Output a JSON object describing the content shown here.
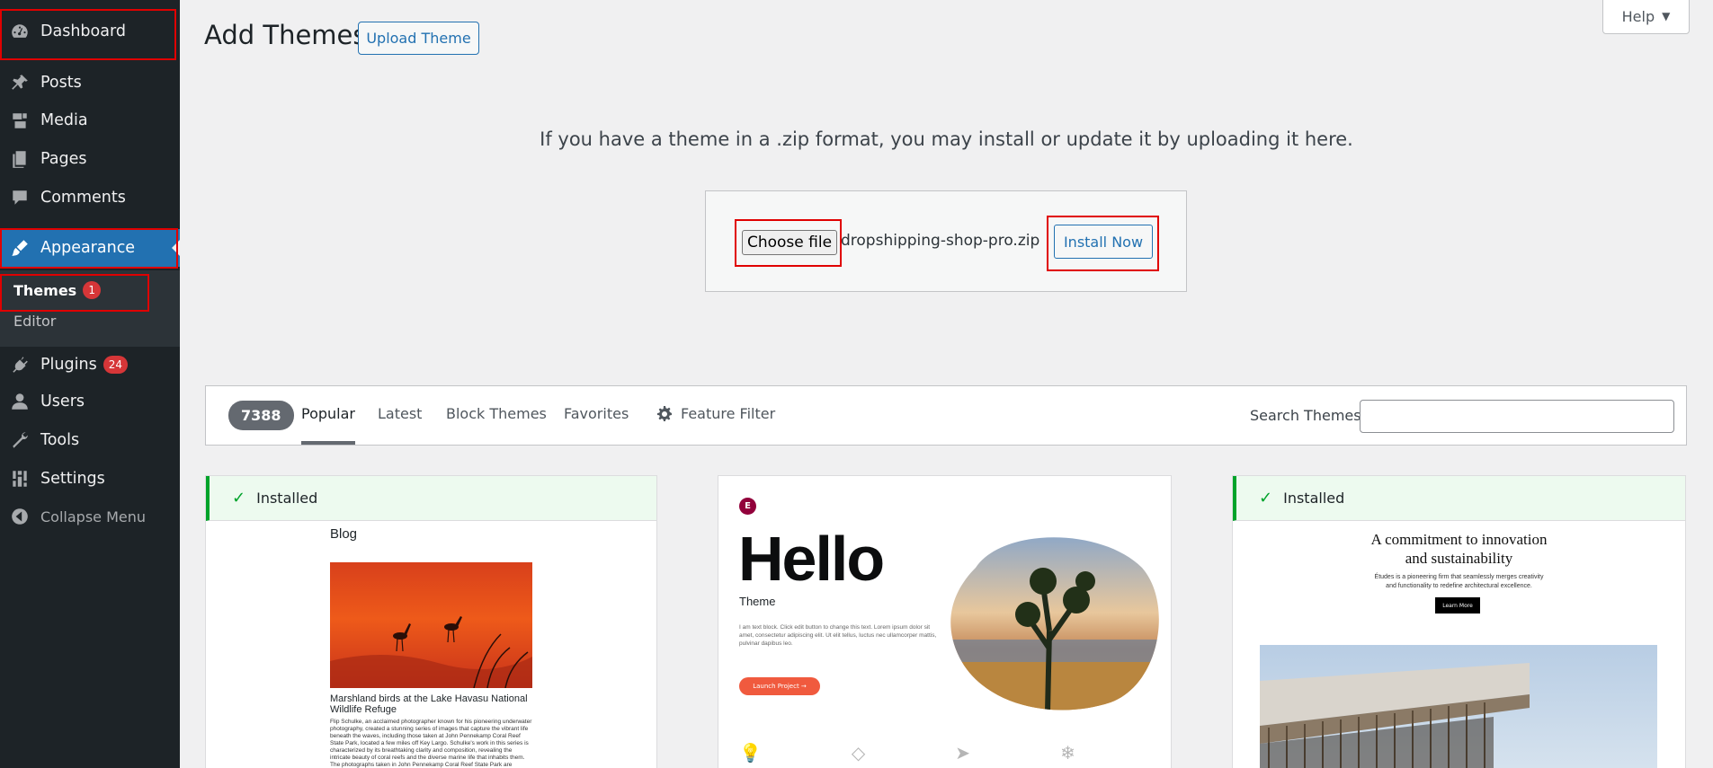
{
  "sidebar": {
    "dashboard": "Dashboard",
    "posts": "Posts",
    "media": "Media",
    "pages": "Pages",
    "comments": "Comments",
    "appearance": "Appearance",
    "themes": "Themes",
    "themes_count": "1",
    "editor": "Editor",
    "plugins": "Plugins",
    "plugins_count": "24",
    "users": "Users",
    "tools": "Tools",
    "settings": "Settings",
    "collapse": "Collapse Menu"
  },
  "header": {
    "title": "Add Themes",
    "upload_button": "Upload Theme",
    "help": "Help"
  },
  "upload": {
    "message": "If you have a theme in a .zip format, you may install or update it by uploading it here.",
    "choose_file": "Choose file",
    "file_name": "dropshipping-shop-pro.zip",
    "install_now": "Install Now"
  },
  "filter": {
    "count": "7388",
    "tabs": [
      "Popular",
      "Latest",
      "Block Themes",
      "Favorites"
    ],
    "feature_filter": "Feature Filter",
    "search_label": "Search Themes",
    "search_value": ""
  },
  "themes": [
    {
      "installed": "Installed",
      "preview_title": "Blog",
      "preview_caption": "Marshland birds at the Lake Havasu National Wildlife Refuge",
      "preview_body": "Flip Schulke, an acclaimed photographer known for his pioneering underwater photography, created a stunning series of images that capture the vibrant life beneath the waves, including those taken at John Pennekamp Coral Reef State Park, located a few miles off Key Largo. Schulke's work in this series is characterized by its breathtaking clarity and composition, revealing the intricate beauty of coral reefs and the diverse marine life that inhabits them. The photographs taken in John Pennekamp Coral Reef State Park are"
    },
    {
      "preview_logo": "E",
      "preview_title": "Hello",
      "preview_subtitle": "Theme",
      "preview_body": "I am text block. Click edit button to change this text. Lorem ipsum dolor sit amet, consectetur adipiscing elit. Ut elit tellus, luctus nec ullamcorper mattis, pulvinar dapibus leo.",
      "preview_button": "Launch Project →"
    },
    {
      "installed": "Installed",
      "preview_heading_1": "A commitment to innovation",
      "preview_heading_2": "and sustainability",
      "preview_body_1": "Études is a pioneering firm that seamlessly merges creativity",
      "preview_body_2": "and functionality to redefine architectural excellence.",
      "preview_button": "Learn More"
    }
  ],
  "colors": {
    "sidebar_bg": "#1d2327",
    "accent": "#2271b1",
    "badge": "#d63638",
    "installed": "#00a32a",
    "annotation": "#e00000"
  }
}
